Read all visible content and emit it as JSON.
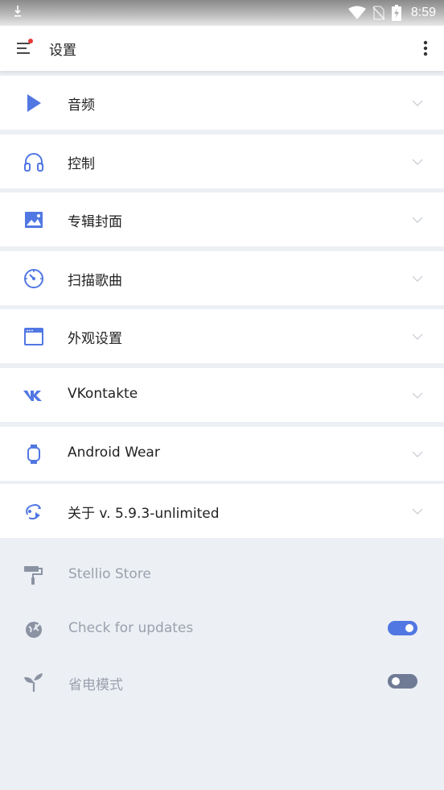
{
  "status_bar": {
    "time": "8:59",
    "icons": [
      "download-icon",
      "wifi-icon",
      "no-sim-icon",
      "battery-charging-icon"
    ]
  },
  "app_bar": {
    "title": "设置",
    "menu_icon": "hamburger-menu-icon",
    "overflow_icon": "more-vert-icon",
    "badge_color": "#e53935"
  },
  "sections": [
    {
      "label": "音频",
      "icon": "play-icon"
    },
    {
      "label": "控制",
      "icon": "headphones-icon"
    },
    {
      "label": "专辑封面",
      "icon": "image-icon"
    },
    {
      "label": "扫描歌曲",
      "icon": "gauge-icon"
    },
    {
      "label": "外观设置",
      "icon": "window-icon"
    },
    {
      "label": "VKontakte",
      "icon": "vk-icon"
    },
    {
      "label": "Android Wear",
      "icon": "watch-icon"
    },
    {
      "label": "关于 v. 5.9.3-unlimited",
      "icon": "info-swirl-icon"
    }
  ],
  "settings": [
    {
      "label": "Stellio Store",
      "icon": "paint-roller-icon"
    },
    {
      "label": "Check for updates",
      "icon": "update-globe-icon",
      "toggle": true
    },
    {
      "label": "省电模式",
      "icon": "sprout-icon",
      "toggle": false
    }
  ],
  "colors": {
    "accent": "#5177e3",
    "toggle_off": "#6f7b95",
    "background": "#eceff4",
    "muted_text": "#9aa1ae"
  }
}
